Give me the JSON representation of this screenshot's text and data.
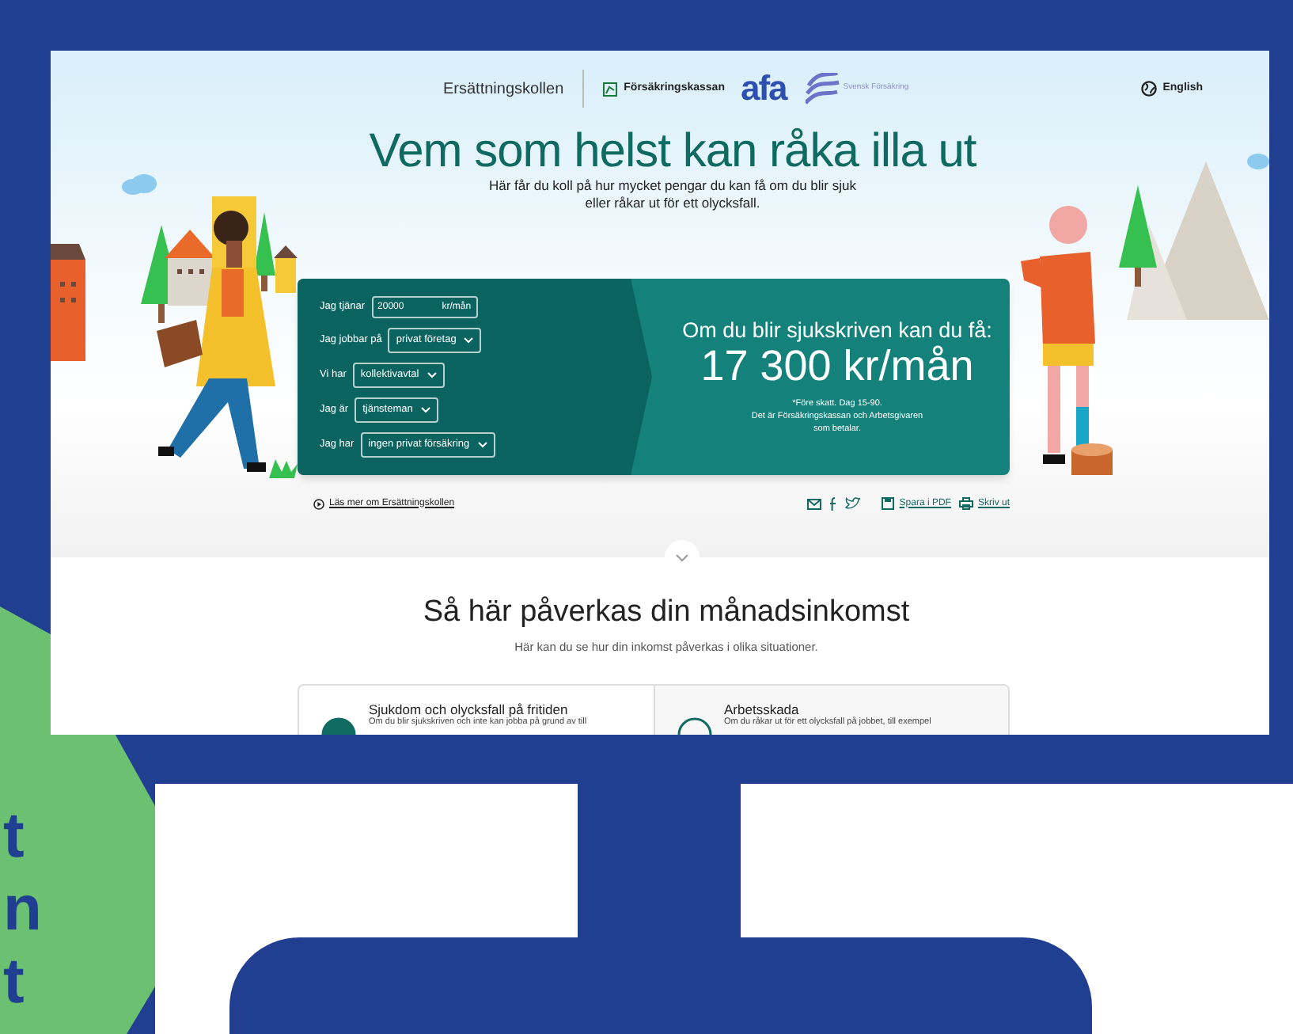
{
  "header": {
    "site_name": "Ersättningskollen",
    "logos": {
      "forsakringskassan": "Försäkringskassan",
      "afa": "afa",
      "svensk_forsakring": "Svensk Försäkring"
    },
    "language": "English"
  },
  "hero": {
    "title": "Vem som helst kan råka illa ut",
    "subtitle": [
      "Här får du koll på hur mycket pengar du kan få om du blir sjuk",
      "eller råkar ut för ett olycksfall."
    ]
  },
  "calculator": {
    "fields": [
      {
        "kind": "input",
        "label": "Jag tjänar",
        "value": "20000",
        "unit": "kr/mån"
      },
      {
        "kind": "select",
        "label": "Jag jobbar på",
        "value": "privat företag"
      },
      {
        "kind": "select",
        "label": "Vi har",
        "value": "kollektivavtal"
      },
      {
        "kind": "select",
        "label": "Jag är",
        "value": "tjänsteman"
      },
      {
        "kind": "select",
        "label": "Jag har",
        "value": "ingen privat försäkring"
      }
    ],
    "result": {
      "heading": "Om du blir sjukskriven kan du få:",
      "amount": "17 300 kr/mån",
      "note": [
        "*Före skatt. Dag 15-90.",
        "Det är Försäkringskassan och Arbetsgivaren",
        "som betalar."
      ]
    }
  },
  "links": {
    "read_more": "Läs mer om Ersättningskollen",
    "save_pdf": "Spara i PDF",
    "print": "Skriv ut"
  },
  "section": {
    "title": "Så här påverkas din månadsinkomst",
    "subtitle": "Här kan du se hur din inkomst påverkas i olika situationer.",
    "cards": [
      {
        "title": "Sjukdom och olycksfall på fritiden",
        "text": "Om du blir sjukskriven och inte kan jobba på grund av till"
      },
      {
        "title": "Arbetsskada",
        "text": "Om du råkar ut för ett olycksfall på jobbet, till exempel"
      }
    ]
  },
  "badge": {
    "lines": [
      "t",
      "n",
      "t"
    ]
  }
}
